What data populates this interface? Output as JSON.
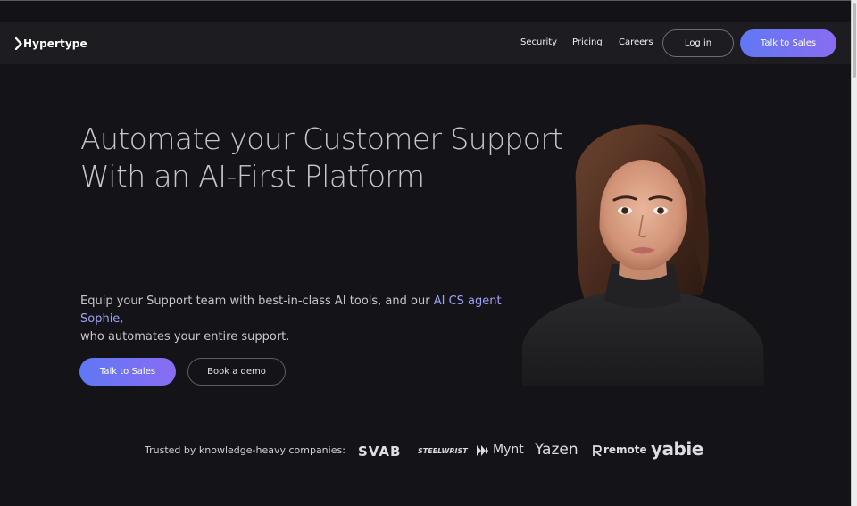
{
  "header": {
    "logo_text": "Hypertype",
    "nav": [
      "Security",
      "Pricing",
      "Careers"
    ],
    "login_label": "Log in",
    "sales_label": "Talk to Sales"
  },
  "hero": {
    "title_line1": "Automate your Customer Support",
    "title_line2": "With an AI-First Platform",
    "subtitle_part1": "Equip your Support team with best-in-class AI tools, and our",
    "subtitle_highlight": "AI CS agent Sophie,",
    "subtitle_part2": "who automates your entire support.",
    "primary_cta": "Talk to Sales",
    "secondary_cta": "Book a demo"
  },
  "trusted": {
    "label": "Trusted by knowledge-heavy companies:",
    "companies": [
      "SVAB",
      "STEELWRIST",
      "Mynt",
      "Yazen",
      "remote",
      "yabie"
    ]
  },
  "colors": {
    "background": "#141318",
    "header": "#1d1c21",
    "accent_start": "#5f78f5",
    "accent_end": "#8a6cf2",
    "highlight": "#9da3f7"
  }
}
